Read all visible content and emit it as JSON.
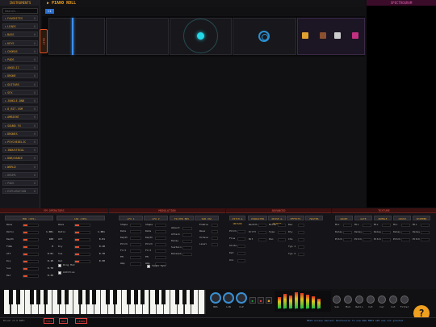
{
  "sidebar": {
    "title": "INSTRUMENTS",
    "search_placeholder": "Search...",
    "items": [
      {
        "label": "FAVORITES",
        "tail": "0"
      },
      {
        "label": "LEADS",
        "tail": "0"
      },
      {
        "label": "BASS",
        "tail": "0"
      },
      {
        "label": "KEYS",
        "tail": "0"
      },
      {
        "label": "CHORDS",
        "tail": "0"
      },
      {
        "label": "PADS",
        "tail": "0"
      },
      {
        "label": "ANGELIC",
        "tail": "0"
      },
      {
        "label": "DRONE",
        "tail": "0"
      },
      {
        "label": "GUITARS",
        "tail": "0"
      },
      {
        "label": "SFX",
        "tail": "0"
      },
      {
        "label": "JUNGLE-DNB",
        "tail": "0"
      },
      {
        "label": "8_BIT-VGM",
        "tail": "0"
      },
      {
        "label": "AMBIENT",
        "tail": "0"
      },
      {
        "label": "SOUND FX",
        "tail": "0"
      },
      {
        "label": "DRONES",
        "tail": "0"
      },
      {
        "label": "PSYCHEDELIC",
        "tail": "0"
      },
      {
        "label": "INDUSTRIAL",
        "tail": "0"
      },
      {
        "label": "DNB/DANCE",
        "tail": "0"
      },
      {
        "label": "WORLD",
        "tail": "0"
      },
      {
        "label": "DRUMS",
        "tail": "0"
      },
      {
        "label": "PADS",
        "tail": "0"
      },
      {
        "label": "EXPLORATION",
        "tail": "0"
      }
    ]
  },
  "piano_roll": {
    "title": "PIANO ROLL",
    "tab": "C1",
    "side_tab": "EDIT"
  },
  "spectrogram": {
    "title": "SPECTROGRAM"
  },
  "sections": {
    "fm": "FM OPERATORS",
    "mod": "MODULATION",
    "adv": "ADVANCED",
    "tex": "TEXTURE"
  },
  "fm": {
    "op1_title": "MOD (OP1)",
    "op2_title": "CAR (OP2)",
    "op1_rows": [
      {
        "label": "Wave",
        "value": ""
      },
      {
        "label": "Ratio",
        "value": "1.00x"
      },
      {
        "label": "Depth",
        "value": "100"
      },
      {
        "label": "Fdbk",
        "value": "0"
      },
      {
        "label": "Att",
        "value": "0.01"
      },
      {
        "label": "Dcy",
        "value": "0.10"
      },
      {
        "label": "Sus",
        "value": "0.70"
      },
      {
        "label": "Rel",
        "value": "0.30"
      }
    ],
    "op2_rows": [
      {
        "label": "Wave",
        "value": ""
      },
      {
        "label": "Ratio",
        "value": "1.00x"
      },
      {
        "label": "Att",
        "value": "0.01"
      },
      {
        "label": "Dcy",
        "value": "0.10"
      },
      {
        "label": "Sus",
        "value": "0.70"
      },
      {
        "label": "Rel",
        "value": "0.30"
      }
    ],
    "ring_mod": "Ring Mod",
    "additive": "Additive"
  },
  "mod": {
    "lfo1": "LFO 1",
    "lfo2": "LFO 2",
    "filter_env": "FILTER ENV",
    "sub_osc": "SUB OSC",
    "lfo_rows": [
      "Shape",
      "Rate",
      "Depth",
      "Pitch",
      "Filt",
      "FM",
      "Amp"
    ],
    "env_rows": [
      "Amount",
      "Attack",
      "Decay",
      "Sustain",
      "Release"
    ],
    "sub_rows": [
      "Enable",
      "Wave",
      "Octave",
      "Level"
    ],
    "tempo_sync": "Tempo Sync"
  },
  "adv": {
    "pitch": "PITCH & UNISON",
    "character": "CHARACTER",
    "noise": "NOISE & OUTPUT",
    "effects": "EFFECTS",
    "master": "MASTER",
    "rows": [
      "Pitch",
      "Fine",
      "Glide",
      "Det",
      "Uni"
    ],
    "char_rows": [
      "Warmth",
      "Drift",
      "Bit"
    ],
    "noise_rows": [
      "Noise",
      "Type",
      "Pan"
    ],
    "fx_rows": [
      "Rev",
      "Dly",
      "Cho",
      "Typ 1",
      "Typ 2"
    ]
  },
  "tex": {
    "heads": [
      "GRANT",
      "GATE",
      "RUMBLE",
      "CRUSH",
      "SHIMMER"
    ],
    "rows": [
      "Mix",
      "Delay",
      "Pitch"
    ]
  },
  "controls": {
    "knobs": [
      "BRS",
      "LIN",
      "CLP"
    ],
    "mix_knobs": [
      "Sub",
      "Mod",
      "Ratio",
      "Cut",
      "Car",
      "Cut",
      "Filter"
    ],
    "meter_labels": [
      "1",
      "2",
      "3",
      "4",
      "5",
      "6",
      "7",
      "8"
    ],
    "help": "?"
  },
  "status": {
    "left": "BlooD v2.0  BPM:",
    "buttons": [
      "TEST",
      "WAV",
      "LEARN"
    ],
    "right": "MIDI access denied: Permission to use Web MIDI API was not granted."
  }
}
